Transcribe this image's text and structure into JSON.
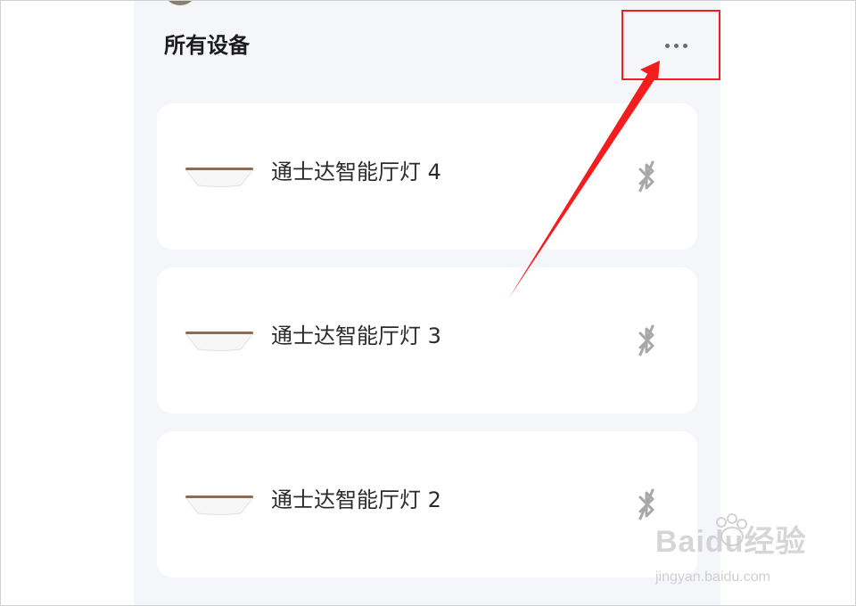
{
  "header": {
    "title": "所有设备",
    "more_icon": "more-horizontal-icon"
  },
  "devices": [
    {
      "name": "通士达智能厅灯 4",
      "icon": "ceiling-lamp-icon",
      "status_icon": "bluetooth-disconnected-icon"
    },
    {
      "name": "通士达智能厅灯 3",
      "icon": "ceiling-lamp-icon",
      "status_icon": "bluetooth-disconnected-icon"
    },
    {
      "name": "通士达智能厅灯 2",
      "icon": "ceiling-lamp-icon",
      "status_icon": "bluetooth-disconnected-icon"
    }
  ],
  "annotation": {
    "color": "#f21e1e"
  },
  "watermark": {
    "logo": "Baidu经验",
    "url": "jingyan.baidu.com"
  }
}
